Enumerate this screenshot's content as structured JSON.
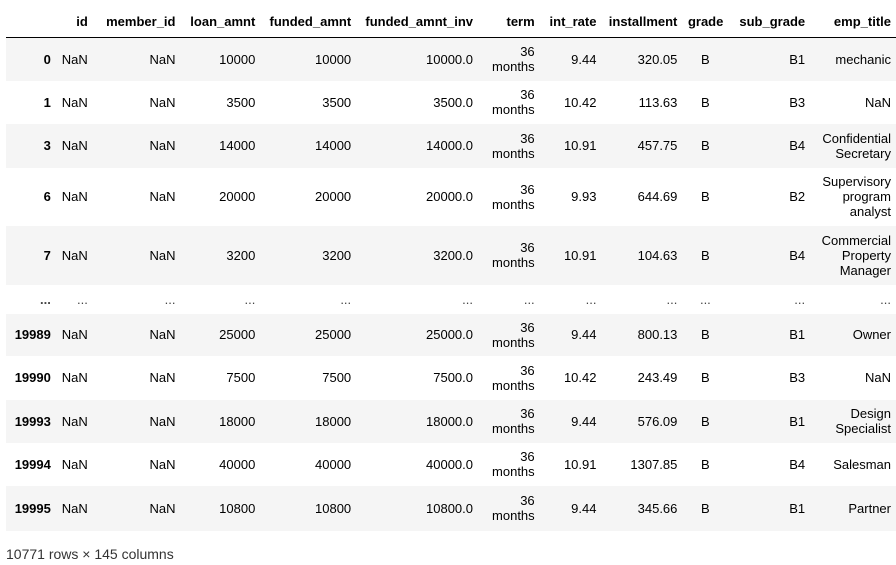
{
  "table": {
    "columns": [
      "",
      "id",
      "member_id",
      "loan_amnt",
      "funded_amnt",
      "funded_amnt_inv",
      "term",
      "int_rate",
      "installment",
      "grade",
      "sub_grade",
      "emp_title"
    ],
    "rows": [
      {
        "index": "0",
        "cells": [
          "NaN",
          "NaN",
          "10000",
          "10000",
          "10000.0",
          "36 months",
          "9.44",
          "320.05",
          "B",
          "B1",
          "mechanic"
        ]
      },
      {
        "index": "1",
        "cells": [
          "NaN",
          "NaN",
          "3500",
          "3500",
          "3500.0",
          "36 months",
          "10.42",
          "113.63",
          "B",
          "B3",
          "NaN"
        ]
      },
      {
        "index": "3",
        "cells": [
          "NaN",
          "NaN",
          "14000",
          "14000",
          "14000.0",
          "36 months",
          "10.91",
          "457.75",
          "B",
          "B4",
          "Confidential Secretary"
        ]
      },
      {
        "index": "6",
        "cells": [
          "NaN",
          "NaN",
          "20000",
          "20000",
          "20000.0",
          "36 months",
          "9.93",
          "644.69",
          "B",
          "B2",
          "Supervisory program analyst"
        ]
      },
      {
        "index": "7",
        "cells": [
          "NaN",
          "NaN",
          "3200",
          "3200",
          "3200.0",
          "36 months",
          "10.91",
          "104.63",
          "B",
          "B4",
          "Commercial Property Manager"
        ]
      },
      {
        "index": "...",
        "cells": [
          "...",
          "...",
          "...",
          "...",
          "...",
          "...",
          "...",
          "...",
          "...",
          "...",
          "..."
        ]
      },
      {
        "index": "19989",
        "cells": [
          "NaN",
          "NaN",
          "25000",
          "25000",
          "25000.0",
          "36 months",
          "9.44",
          "800.13",
          "B",
          "B1",
          "Owner"
        ]
      },
      {
        "index": "19990",
        "cells": [
          "NaN",
          "NaN",
          "7500",
          "7500",
          "7500.0",
          "36 months",
          "10.42",
          "243.49",
          "B",
          "B3",
          "NaN"
        ]
      },
      {
        "index": "19993",
        "cells": [
          "NaN",
          "NaN",
          "18000",
          "18000",
          "18000.0",
          "36 months",
          "9.44",
          "576.09",
          "B",
          "B1",
          "Design Specialist"
        ]
      },
      {
        "index": "19994",
        "cells": [
          "NaN",
          "NaN",
          "40000",
          "40000",
          "40000.0",
          "36 months",
          "10.91",
          "1307.85",
          "B",
          "B4",
          "Salesman"
        ]
      },
      {
        "index": "19995",
        "cells": [
          "NaN",
          "NaN",
          "10800",
          "10800",
          "10800.0",
          "36 months",
          "9.44",
          "345.66",
          "B",
          "B1",
          "Partner"
        ]
      }
    ]
  },
  "footer": {
    "shape_text": "10771 rows × 145 columns"
  }
}
